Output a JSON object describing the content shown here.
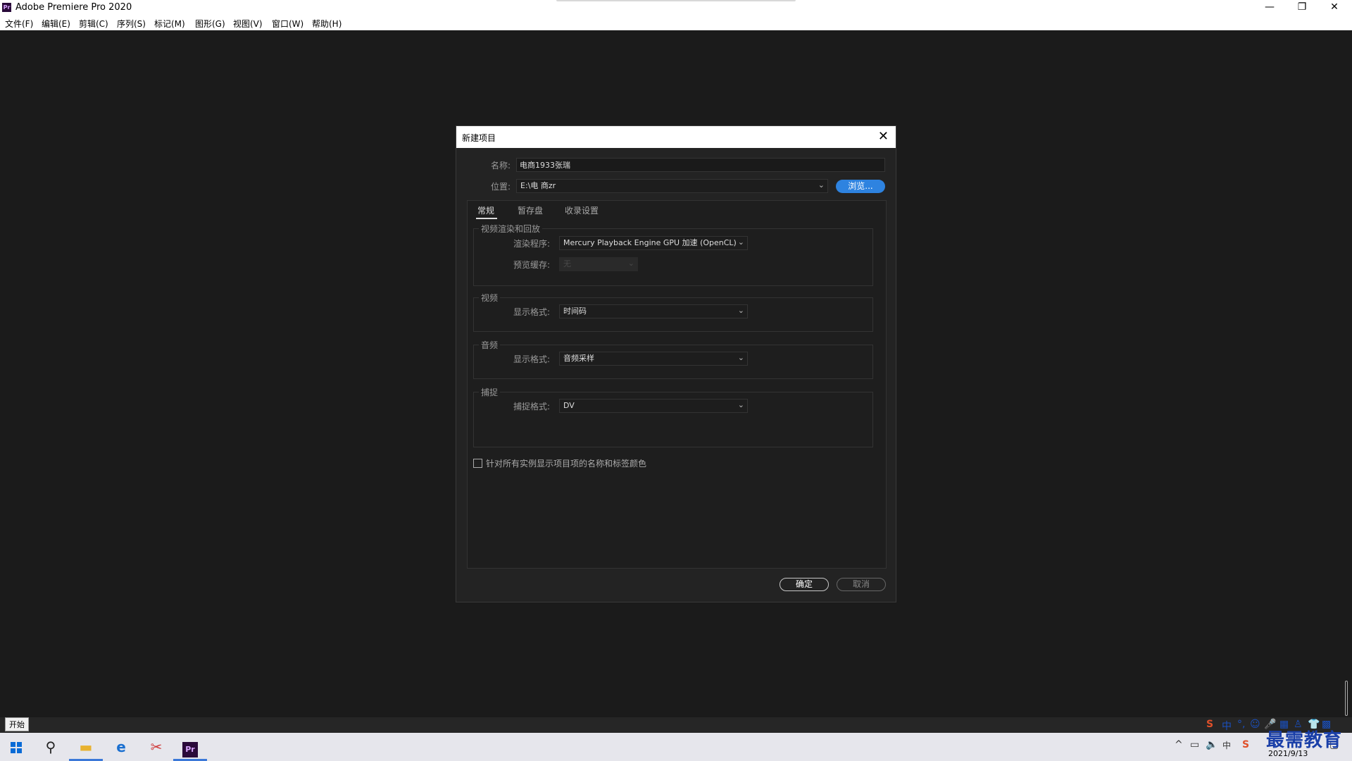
{
  "window": {
    "title": "Adobe Premiere Pro 2020",
    "logo_text": "Pr",
    "controls": {
      "minimize": "—",
      "restore": "❐",
      "close": "✕"
    }
  },
  "menu": [
    "文件(F)",
    "编辑(E)",
    "剪辑(C)",
    "序列(S)",
    "标记(M)",
    "图形(G)",
    "视图(V)",
    "窗口(W)",
    "帮助(H)"
  ],
  "dialog": {
    "title": "新建项目",
    "close": "✕",
    "name_label": "名称:",
    "name_value": "电商1933张瑞",
    "location_label": "位置:",
    "location_value": "E:\\电 商zr",
    "browse_label": "浏览...",
    "tabs": [
      "常规",
      "暂存盘",
      "收录设置"
    ],
    "sections": {
      "render": {
        "title": "视频渲染和回放",
        "renderer_label": "渲染程序:",
        "renderer_value": "Mercury Playback Engine GPU 加速 (OpenCL)",
        "preview_cache_label": "预览缓存:",
        "preview_cache_value": "无"
      },
      "video": {
        "title": "视频",
        "format_label": "显示格式:",
        "format_value": "时间码"
      },
      "audio": {
        "title": "音频",
        "format_label": "显示格式:",
        "format_value": "音频采样"
      },
      "capture": {
        "title": "捕捉",
        "format_label": "捕捉格式:",
        "format_value": "DV"
      }
    },
    "checkbox_label": "针对所有实例显示项目项的名称和标签颜色",
    "ok_label": "确定",
    "cancel_label": "取消"
  },
  "taskbar": {
    "start_tooltip": "开始",
    "clock_time": "",
    "clock_date": "2021/9/13",
    "apps": [
      "search-icon",
      "file-explorer-icon",
      "edge-icon",
      "snipping-icon",
      "premiere-icon"
    ]
  },
  "watermark": "最需教育",
  "ime": {
    "logo": "S",
    "mode": "中"
  }
}
